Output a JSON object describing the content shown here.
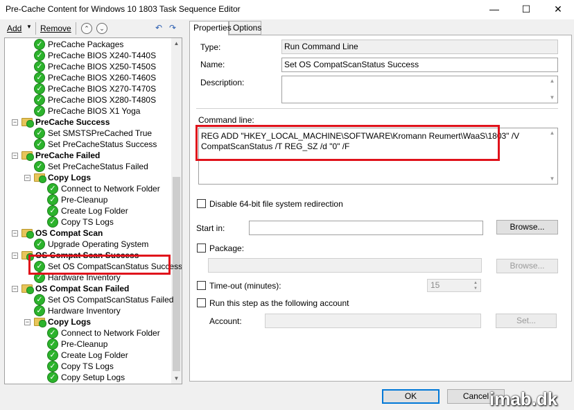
{
  "window": {
    "title": "Pre-Cache Content for Windows 10 1803 Task Sequence Editor",
    "minimize": "—",
    "maximize": "☐",
    "close": "✕"
  },
  "toolbar": {
    "add_label": "Add",
    "add_arrow": "▼",
    "remove_label": "Remove",
    "up_glyph": "⌃",
    "down_glyph": "⌄",
    "icon1_glyph": "↶",
    "icon2_glyph": "↷"
  },
  "tree": {
    "items": [
      {
        "label": "PreCache Packages",
        "type": "step",
        "depth": 2
      },
      {
        "label": "PreCache BIOS X240-T440S",
        "type": "step",
        "depth": 2
      },
      {
        "label": "PreCache BIOS X250-T450S",
        "type": "step",
        "depth": 2
      },
      {
        "label": "PreCache BIOS X260-T460S",
        "type": "step",
        "depth": 2
      },
      {
        "label": "PreCache BIOS X270-T470S",
        "type": "step",
        "depth": 2
      },
      {
        "label": "PreCache BIOS X280-T480S",
        "type": "step",
        "depth": 2
      },
      {
        "label": "PreCache BIOS X1 Yoga",
        "type": "step",
        "depth": 2
      },
      {
        "label": "PreCache Success",
        "type": "group",
        "depth": 1
      },
      {
        "label": "Set SMSTSPreCached True",
        "type": "step",
        "depth": 2
      },
      {
        "label": "Set PreCacheStatus Success",
        "type": "step",
        "depth": 2
      },
      {
        "label": "PreCache Failed",
        "type": "group",
        "depth": 1
      },
      {
        "label": "Set PreCacheStatus Failed",
        "type": "step",
        "depth": 2
      },
      {
        "label": "Copy Logs",
        "type": "group",
        "depth": 2
      },
      {
        "label": "Connect to Network Folder",
        "type": "step",
        "depth": 3
      },
      {
        "label": "Pre-Cleanup",
        "type": "step",
        "depth": 3
      },
      {
        "label": "Create Log Folder",
        "type": "step",
        "depth": 3
      },
      {
        "label": "Copy TS Logs",
        "type": "step",
        "depth": 3
      },
      {
        "label": "OS Compat Scan",
        "type": "group",
        "depth": 1
      },
      {
        "label": "Upgrade Operating System",
        "type": "step",
        "depth": 2
      },
      {
        "label": "OS Compat Scan Success",
        "type": "group",
        "depth": 1
      },
      {
        "label": "Set OS CompatScanStatus Success",
        "type": "step",
        "depth": 2
      },
      {
        "label": "Hardware Inventory",
        "type": "step",
        "depth": 2
      },
      {
        "label": "OS Compat Scan Failed",
        "type": "group",
        "depth": 1
      },
      {
        "label": "Set OS CompatScanStatus Failed",
        "type": "step",
        "depth": 2
      },
      {
        "label": "Hardware Inventory",
        "type": "step",
        "depth": 2
      },
      {
        "label": "Copy Logs",
        "type": "group",
        "depth": 2
      },
      {
        "label": "Connect to Network Folder",
        "type": "step",
        "depth": 3
      },
      {
        "label": "Pre-Cleanup",
        "type": "step",
        "depth": 3
      },
      {
        "label": "Create Log Folder",
        "type": "step",
        "depth": 3
      },
      {
        "label": "Copy TS Logs",
        "type": "step",
        "depth": 3
      },
      {
        "label": "Copy Setup Logs",
        "type": "step",
        "depth": 3
      }
    ],
    "scroll_up": "▲",
    "scroll_down": "▼"
  },
  "tabs": {
    "properties": "Properties",
    "options": "Options"
  },
  "properties": {
    "type_label": "Type:",
    "type_value": "Run Command Line",
    "name_label": "Name:",
    "name_value": "Set OS CompatScanStatus Success",
    "description_label": "Description:",
    "description_value": "",
    "command_line_label": "Command line:",
    "command_line_value": "REG ADD \"HKEY_LOCAL_MACHINE\\SOFTWARE\\Kromann Reumert\\WaaS\\1803\" /V\nCompatScanStatus /T REG_SZ /d \"0\" /F",
    "disable_64bit_label": "Disable 64-bit file system redirection",
    "start_in_label": "Start in:",
    "start_in_value": "",
    "browse_label": "Browse...",
    "package_label": "Package:",
    "package_value": "",
    "browse_package_label": "Browse...",
    "timeout_label": "Time-out (minutes):",
    "timeout_value": "15",
    "run_as_label": "Run this step as the following account",
    "account_label": "Account:",
    "account_value": "",
    "set_label": "Set...",
    "scroll_up": "▲",
    "scroll_down": "▼"
  },
  "footer": {
    "ok_label": "OK",
    "cancel_label": "Cancel",
    "watermark": "imab.dk"
  }
}
